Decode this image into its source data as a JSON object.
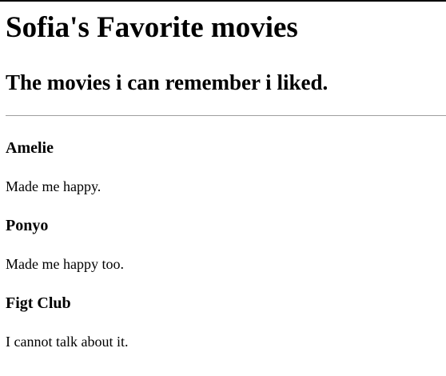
{
  "page": {
    "title": "Sofia's Favorite movies",
    "subtitle": "The movies i can remember i liked."
  },
  "movies": [
    {
      "title": "Amelie",
      "description": "Made me happy."
    },
    {
      "title": "Ponyo",
      "description": "Made me happy too."
    },
    {
      "title": "Figt Club",
      "description": "I cannot talk about it."
    }
  ],
  "colors": {
    "text": "#000000",
    "rule": "#9e9e9e",
    "background": "#ffffff"
  }
}
